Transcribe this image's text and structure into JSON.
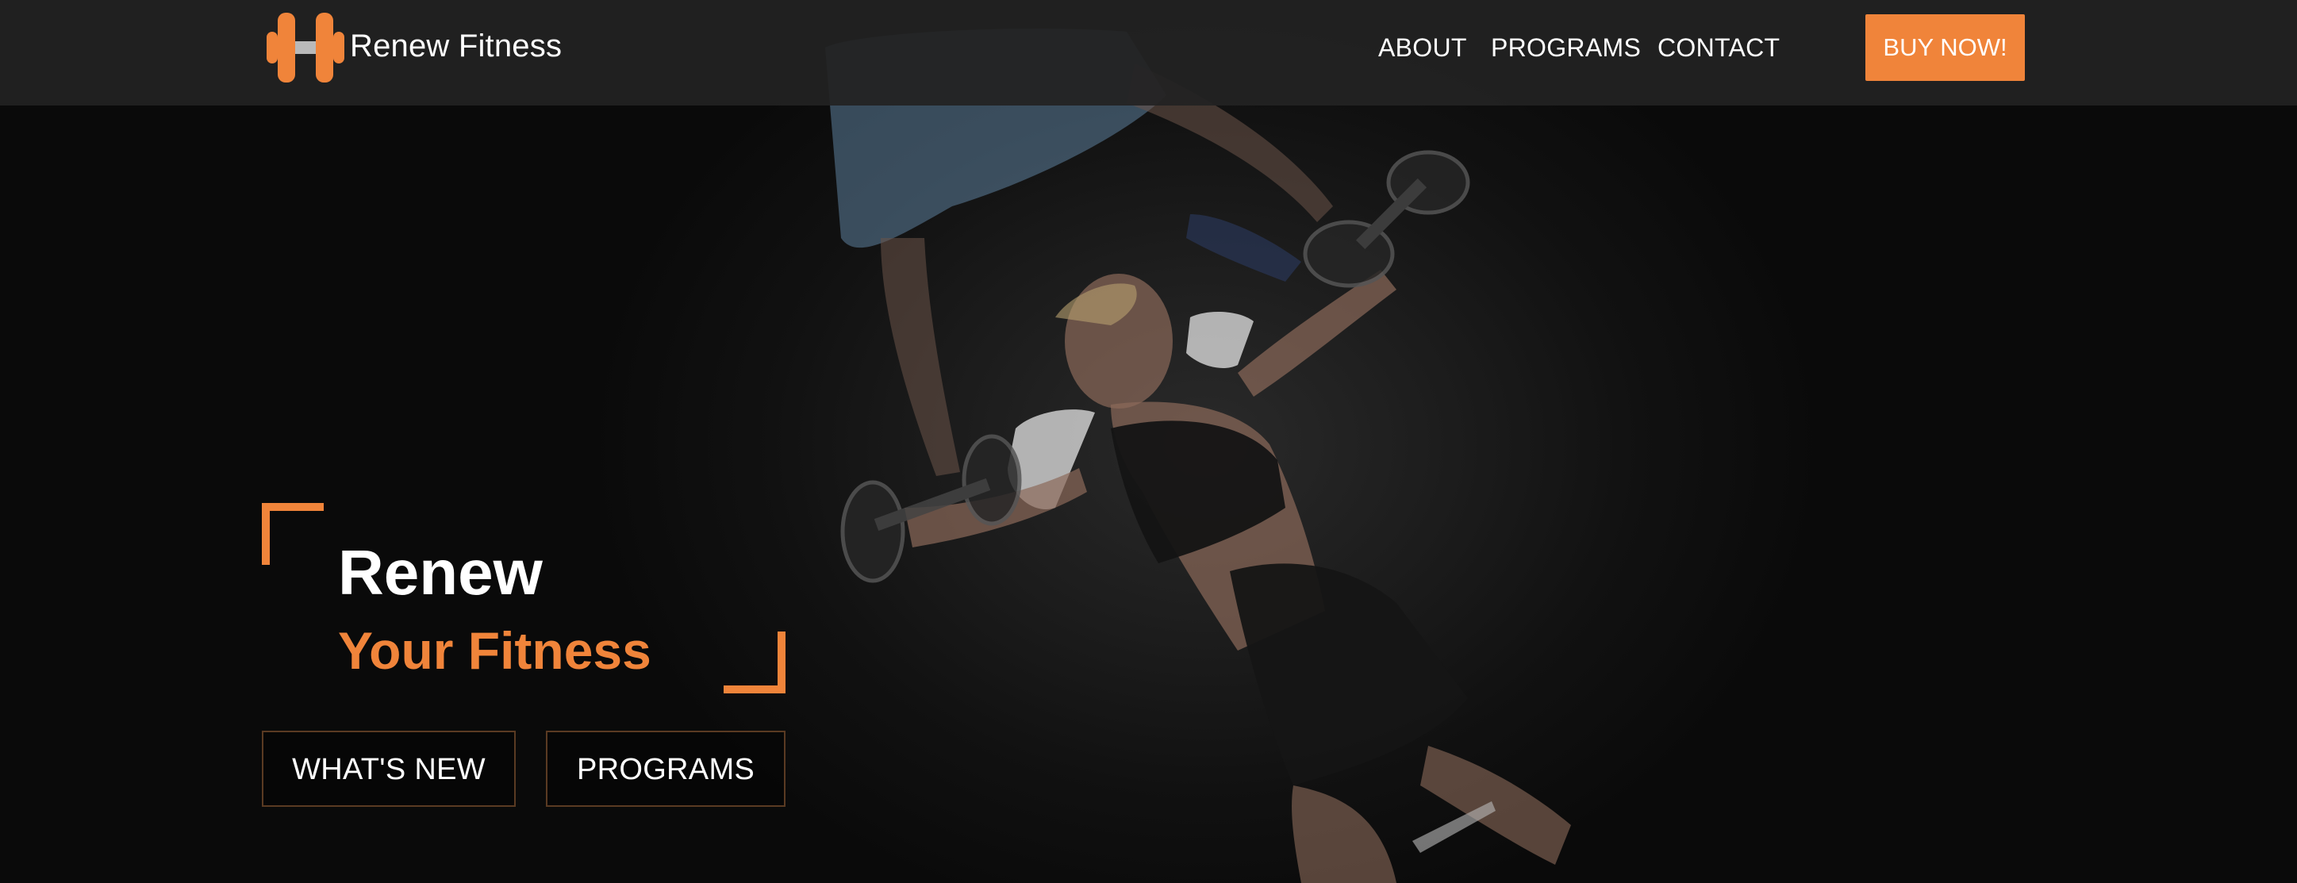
{
  "brand": {
    "name": "Renew Fitness",
    "icon": "dumbbell-icon"
  },
  "nav": {
    "items": [
      {
        "label": "ABOUT"
      },
      {
        "label": "PROGRAMS"
      },
      {
        "label": "CONTACT"
      }
    ],
    "cta_label": "BUY NOW!"
  },
  "hero": {
    "title": "Renew",
    "subtitle": "Your Fitness",
    "buttons": [
      {
        "label": "WHAT'S NEW"
      },
      {
        "label": "PROGRAMS"
      }
    ],
    "background_image": "workout-photo"
  },
  "colors": {
    "accent": "#f0843a",
    "nav_bg": "#222222",
    "page_bg": "#0a0a0a",
    "text": "#ffffff"
  }
}
